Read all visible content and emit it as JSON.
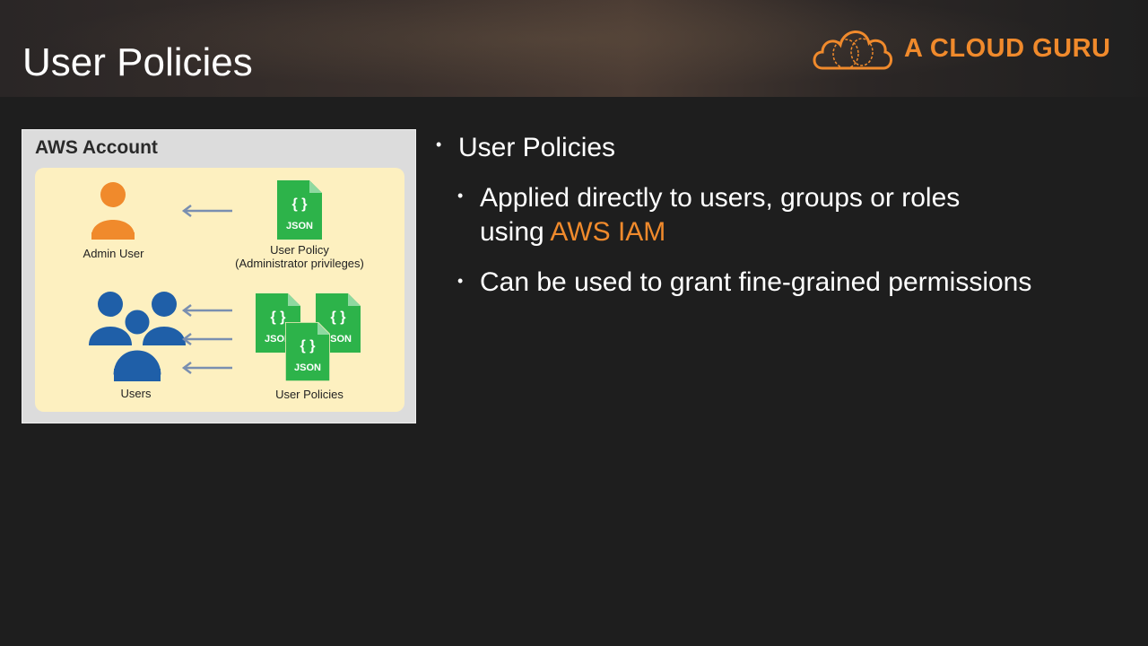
{
  "slide": {
    "title": "User Policies"
  },
  "logo": {
    "text": "A CLOUD GURU"
  },
  "diagram": {
    "title": "AWS Account",
    "admin_user_label": "Admin User",
    "user_policy_label_line1": "User Policy",
    "user_policy_label_line2": "(Administrator privileges)",
    "users_label": "Users",
    "user_policies_label": "User Policies",
    "json_text": "JSON",
    "json_braces": "{ }"
  },
  "bullets": {
    "main": "User Policies",
    "sub1_line1": "Applied directly to users, groups or roles",
    "sub1_line2_prefix": "using ",
    "sub1_line2_accent": "AWS IAM",
    "sub2": "Can be used to grant fine-grained permissions"
  },
  "colors": {
    "accent": "#f08a2c",
    "json_green": "#2db34a",
    "user_blue": "#1f5fa8",
    "admin_orange": "#f08a2c"
  }
}
